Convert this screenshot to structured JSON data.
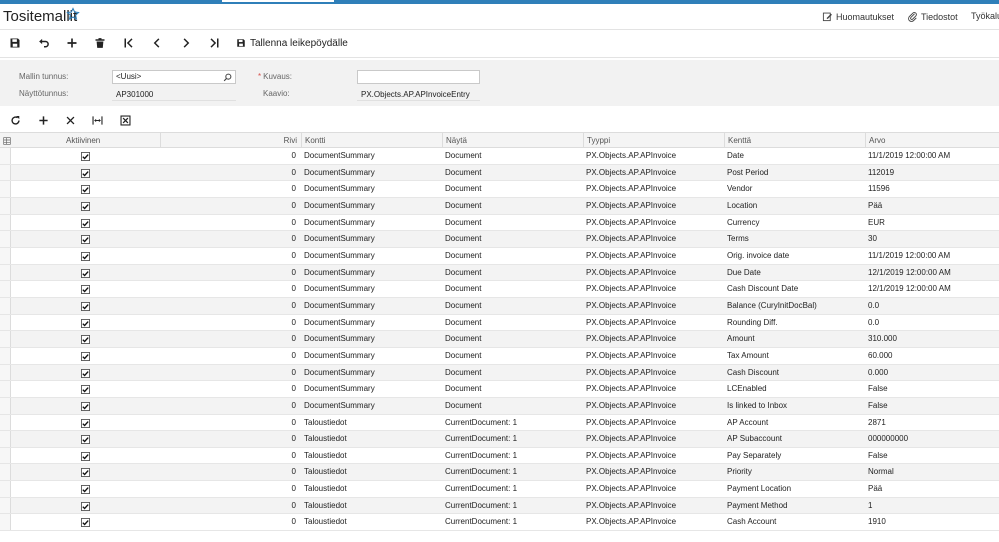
{
  "header": {
    "title": "Tositemallit",
    "links": [
      {
        "label": "Huomautukset",
        "icon": "note-edit-icon"
      },
      {
        "label": "Tiedostot",
        "icon": "paperclip-icon"
      },
      {
        "label": "Työkalu",
        "icon": ""
      }
    ]
  },
  "toolbar": {
    "save_clipboard_label": "Tallenna leikepöydälle"
  },
  "form": {
    "template_id_label": "Mallin tunnus:",
    "template_id_value": "<Uusi>",
    "description_label": "Kuvaus:",
    "description_value": "",
    "screen_id_label": "Näyttötunnus:",
    "screen_id_value": "AP301000",
    "graph_label": "Kaavio:",
    "graph_value": "PX.Objects.AP.APInvoiceEntry"
  },
  "grid": {
    "columns": {
      "active": "Aktiivinen",
      "row": "Rivi",
      "container": "Kontti",
      "view": "Näytä",
      "type": "Tyyppi",
      "field": "Kenttä",
      "value": "Arvo"
    },
    "rows": [
      {
        "row": "0",
        "container": "DocumentSummary",
        "view": "Document",
        "type": "PX.Objects.AP.APInvoice",
        "field": "Date",
        "value": "11/1/2019 12:00:00 AM"
      },
      {
        "row": "0",
        "container": "DocumentSummary",
        "view": "Document",
        "type": "PX.Objects.AP.APInvoice",
        "field": "Post Period",
        "value": "112019"
      },
      {
        "row": "0",
        "container": "DocumentSummary",
        "view": "Document",
        "type": "PX.Objects.AP.APInvoice",
        "field": "Vendor",
        "value": "11596"
      },
      {
        "row": "0",
        "container": "DocumentSummary",
        "view": "Document",
        "type": "PX.Objects.AP.APInvoice",
        "field": "Location",
        "value": "Pää"
      },
      {
        "row": "0",
        "container": "DocumentSummary",
        "view": "Document",
        "type": "PX.Objects.AP.APInvoice",
        "field": "Currency",
        "value": "EUR"
      },
      {
        "row": "0",
        "container": "DocumentSummary",
        "view": "Document",
        "type": "PX.Objects.AP.APInvoice",
        "field": "Terms",
        "value": "30"
      },
      {
        "row": "0",
        "container": "DocumentSummary",
        "view": "Document",
        "type": "PX.Objects.AP.APInvoice",
        "field": "Orig. invoice date",
        "value": "11/1/2019 12:00:00 AM"
      },
      {
        "row": "0",
        "container": "DocumentSummary",
        "view": "Document",
        "type": "PX.Objects.AP.APInvoice",
        "field": "Due Date",
        "value": "12/1/2019 12:00:00 AM"
      },
      {
        "row": "0",
        "container": "DocumentSummary",
        "view": "Document",
        "type": "PX.Objects.AP.APInvoice",
        "field": "Cash Discount Date",
        "value": "12/1/2019 12:00:00 AM"
      },
      {
        "row": "0",
        "container": "DocumentSummary",
        "view": "Document",
        "type": "PX.Objects.AP.APInvoice",
        "field": "Balance (CuryInitDocBal)",
        "value": "0.0"
      },
      {
        "row": "0",
        "container": "DocumentSummary",
        "view": "Document",
        "type": "PX.Objects.AP.APInvoice",
        "field": "Rounding Diff.",
        "value": "0.0"
      },
      {
        "row": "0",
        "container": "DocumentSummary",
        "view": "Document",
        "type": "PX.Objects.AP.APInvoice",
        "field": "Amount",
        "value": "310.000"
      },
      {
        "row": "0",
        "container": "DocumentSummary",
        "view": "Document",
        "type": "PX.Objects.AP.APInvoice",
        "field": "Tax Amount",
        "value": "60.000"
      },
      {
        "row": "0",
        "container": "DocumentSummary",
        "view": "Document",
        "type": "PX.Objects.AP.APInvoice",
        "field": "Cash Discount",
        "value": "0.000"
      },
      {
        "row": "0",
        "container": "DocumentSummary",
        "view": "Document",
        "type": "PX.Objects.AP.APInvoice",
        "field": "LCEnabled",
        "value": "False"
      },
      {
        "row": "0",
        "container": "DocumentSummary",
        "view": "Document",
        "type": "PX.Objects.AP.APInvoice",
        "field": "Is linked to Inbox",
        "value": "False"
      },
      {
        "row": "0",
        "container": "Taloustiedot",
        "view": "CurrentDocument: 1",
        "type": "PX.Objects.AP.APInvoice",
        "field": "AP Account",
        "value": "2871"
      },
      {
        "row": "0",
        "container": "Taloustiedot",
        "view": "CurrentDocument: 1",
        "type": "PX.Objects.AP.APInvoice",
        "field": "AP Subaccount",
        "value": "000000000"
      },
      {
        "row": "0",
        "container": "Taloustiedot",
        "view": "CurrentDocument: 1",
        "type": "PX.Objects.AP.APInvoice",
        "field": "Pay Separately",
        "value": "False"
      },
      {
        "row": "0",
        "container": "Taloustiedot",
        "view": "CurrentDocument: 1",
        "type": "PX.Objects.AP.APInvoice",
        "field": "Priority",
        "value": "Normal"
      },
      {
        "row": "0",
        "container": "Taloustiedot",
        "view": "CurrentDocument: 1",
        "type": "PX.Objects.AP.APInvoice",
        "field": "Payment Location",
        "value": "Pää"
      },
      {
        "row": "0",
        "container": "Taloustiedot",
        "view": "CurrentDocument: 1",
        "type": "PX.Objects.AP.APInvoice",
        "field": "Payment Method",
        "value": "1"
      },
      {
        "row": "0",
        "container": "Taloustiedot",
        "view": "CurrentDocument: 1",
        "type": "PX.Objects.AP.APInvoice",
        "field": "Cash Account",
        "value": "1910"
      }
    ]
  }
}
